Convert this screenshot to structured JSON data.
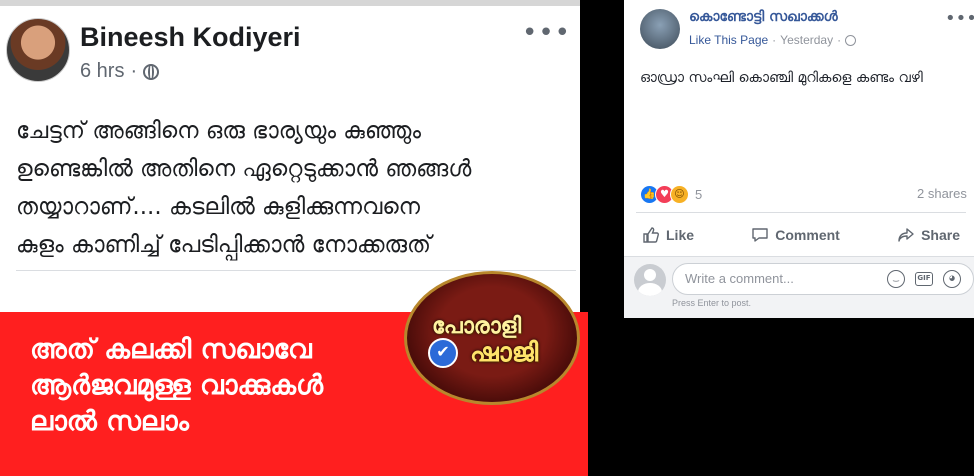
{
  "left_post": {
    "author": "Bineesh Kodiyeri",
    "time": "6 hrs",
    "separator": "·",
    "menu": "•••",
    "body_lines": [
      "ചേട്ടന് അങ്ങിനെ ഒരു ഭാര്യയും കുഞ്ഞും",
      "ഉണ്ടെങ്കിൽ അതിനെ ഏറ്റെടുക്കാൻ ഞങ്ങൾ",
      "തയ്യാറാണ്....  കടലിൽ കുളിക്കുന്നവനെ",
      "കുളം കാണിച്ച് പേടിപ്പിക്കാൻ നോക്കരുത്"
    ]
  },
  "banner": {
    "lines": [
      "അത് കലക്കി സഖാവേ",
      "ആർജവമുള്ള വാക്കുകൾ",
      "ലാൽ സലാം"
    ],
    "logo_top": "പോരാളി",
    "logo_bottom": "ഷാജി",
    "background": "#ff1f1f"
  },
  "right_post": {
    "page_name": "കൊണ്ടോട്ടി സഖാക്കൾ",
    "like_link": "Like This Page",
    "separator": "·",
    "time": "Yesterday",
    "menu": "•••",
    "body": "ഓഡ്രാ സംഘി കൊഞ്ചി മുറികളെ കണ്ടം വഴി",
    "reaction_count": "5",
    "shares": "2 shares",
    "actions": {
      "like": "Like",
      "comment": "Comment",
      "share": "Share"
    },
    "comment_placeholder": "Write a comment...",
    "comment_icons": [
      "smiley-icon",
      "gif-icon",
      "sticker-icon"
    ],
    "gif_label": "GIF",
    "press_enter": "Press Enter to post."
  },
  "colors": {
    "link_blue": "#365899",
    "like_blue": "#1877f2",
    "love_red": "#f33e58",
    "haha_yellow": "#f7b125"
  }
}
